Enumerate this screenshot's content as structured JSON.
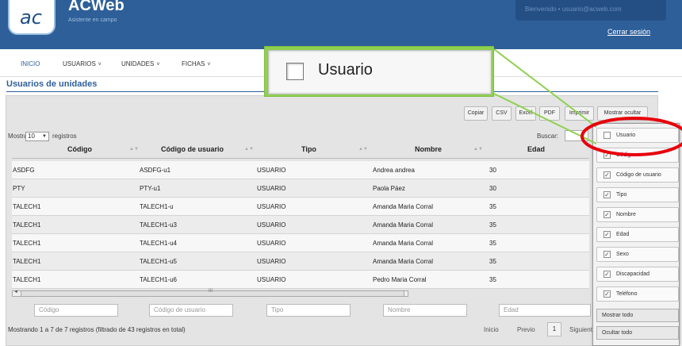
{
  "header": {
    "logo_text": "ac",
    "app_title": "ACWeb",
    "app_subtitle": "Asistente en campo",
    "user_line": "Bienvenido  •  usuario@acweb.com",
    "logout_label": "Cerrar sesión"
  },
  "nav": {
    "items": [
      {
        "label": "INICIO",
        "dropdown": false
      },
      {
        "label": "USUARIOS",
        "dropdown": true
      },
      {
        "label": "UNIDADES",
        "dropdown": true
      },
      {
        "label": "FICHAS",
        "dropdown": true
      }
    ],
    "chevron": "˅"
  },
  "page": {
    "title": "Usuarios de unidades"
  },
  "toolbar": {
    "buttons": [
      "Copiar",
      "CSV",
      "Excel",
      "PDF",
      "Imprimir",
      "Mostrar ocultar"
    ]
  },
  "table_controls": {
    "show_label": "Mostrar",
    "page_size": "10",
    "records_label": "registros",
    "search_label": "Buscar:"
  },
  "table": {
    "columns": [
      "Código",
      "Código de usuario",
      "Tipo",
      "Nombre",
      "Edad"
    ],
    "rows": [
      [
        "ASDFG",
        "ASDFG-u1",
        "USUARIO",
        "Andrea andrea",
        "30"
      ],
      [
        "PTY",
        "PTY-u1",
        "USUARIO",
        "Paola Páez",
        "30"
      ],
      [
        "TALECH1",
        "TALECH1-u",
        "USUARIO",
        "Amanda Maria Corral",
        "35"
      ],
      [
        "TALECH1",
        "TALECH1-u3",
        "USUARIO",
        "Amanda Maria Corral",
        "35"
      ],
      [
        "TALECH1",
        "TALECH1-u4",
        "USUARIO",
        "Amanda Maria Corral",
        "35"
      ],
      [
        "TALECH1",
        "TALECH1-u5",
        "USUARIO",
        "Amanda Maria Corral",
        "35"
      ],
      [
        "TALECH1",
        "TALECH1-u6",
        "USUARIO",
        "Pedro Maria Corral",
        "35"
      ]
    ],
    "filters": [
      "Código",
      "Código de usuario",
      "Tipo",
      "Nombre",
      "Edad"
    ],
    "scroll_grip": "III"
  },
  "footer": {
    "info": "Mostrando 1 a 7 de 7 registros (filtrado de 43 registros en total)",
    "first_label": "Inicio",
    "prev_label": "Previo",
    "page_number": "1",
    "next_label": "Siguiente"
  },
  "column_menu": {
    "items": [
      {
        "label": "Usuario",
        "checked": false
      },
      {
        "label": "Código",
        "checked": true
      },
      {
        "label": "Código de usuario",
        "checked": true
      },
      {
        "label": "Tipo",
        "checked": true
      },
      {
        "label": "Nombre",
        "checked": true
      },
      {
        "label": "Edad",
        "checked": true
      },
      {
        "label": "Sexo",
        "checked": true
      },
      {
        "label": "Discapacidad",
        "checked": true
      },
      {
        "label": "Teléfono",
        "checked": true
      }
    ],
    "show_all_label": "Mostrar todo",
    "hide_all_label": "Ocultar todo",
    "check_glyph": "✓"
  },
  "zoom_callout": {
    "label": "Usuario"
  },
  "colors": {
    "header_blue": "#2e5f99",
    "callout_green": "#8fd14f",
    "highlight_red": "#e8000b"
  }
}
